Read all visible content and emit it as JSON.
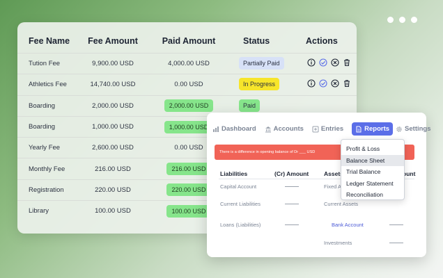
{
  "fees": {
    "columns": {
      "name": "Fee Name",
      "amount": "Fee Amount",
      "paid": "Paid Amount",
      "status": "Status",
      "actions": "Actions"
    },
    "rows": [
      {
        "name": "Tution Fee",
        "amount": "9,900.00 USD",
        "paid": "4,000.00 USD",
        "paid_highlight": false,
        "status": "Partially Paid",
        "status_kind": "partial",
        "actions": true
      },
      {
        "name": "Athletics Fee",
        "amount": "14,740.00 USD",
        "paid": "0.00 USD",
        "paid_highlight": false,
        "status": "In Progress",
        "status_kind": "progress",
        "actions": true
      },
      {
        "name": "Boarding",
        "amount": "2,000.00 USD",
        "paid": "2,000.00 USD",
        "paid_highlight": true,
        "status": "Paid",
        "status_kind": "paid",
        "actions": false
      },
      {
        "name": "Boarding",
        "amount": "1,000.00 USD",
        "paid": "1,000.00 USD",
        "paid_highlight": true,
        "status": "",
        "status_kind": "",
        "actions": false
      },
      {
        "name": "Yearly Fee",
        "amount": "2,600.00 USD",
        "paid": "0.00 USD",
        "paid_highlight": false,
        "status": "",
        "status_kind": "",
        "actions": false
      },
      {
        "name": "Monthly Fee",
        "amount": "216.00 USD",
        "paid": "216.00 USD",
        "paid_highlight": true,
        "status": "",
        "status_kind": "",
        "actions": false
      },
      {
        "name": "Registration",
        "amount": "220.00 USD",
        "paid": "220.00 USD",
        "paid_highlight": true,
        "status": "",
        "status_kind": "",
        "actions": false
      },
      {
        "name": "Library",
        "amount": "100.00 USD",
        "paid": "100.00 USD",
        "paid_highlight": true,
        "status": "",
        "status_kind": "",
        "actions": false
      }
    ],
    "action_icons": [
      "info-icon",
      "check-circle-icon",
      "cancel-circle-icon",
      "trash-icon"
    ]
  },
  "reports": {
    "nav": {
      "dashboard": "Dashboard",
      "accounts": "Accounts",
      "entries": "Entries",
      "reports": "Reports",
      "settings": "Settings"
    },
    "alert": "There is a difference in opening balance of Dr ___ USD",
    "table": {
      "liabilities": "Liabilities",
      "cr_amount": "(Cr) Amount",
      "assets": "Assets",
      "amount_partial": "ount",
      "liability_rows": [
        "Capital Account",
        "Current Liabilities",
        "Loans (Liabilities)"
      ],
      "asset_rows": [
        "Fixed A",
        "Current Assets",
        "Bank Account",
        "Investments"
      ]
    },
    "dropdown": [
      "Profit & Loss",
      "Balance Sheet",
      "Trial Balance",
      "Ledger Statement",
      "Reconciliation"
    ],
    "dropdown_hover_index": 1
  },
  "colors": {
    "accent": "#5b6ee8",
    "alert": "#f16357",
    "paid_green": "#86e58b",
    "progress_yellow": "#f7e52a",
    "partial_blue": "#d7e1f7"
  }
}
